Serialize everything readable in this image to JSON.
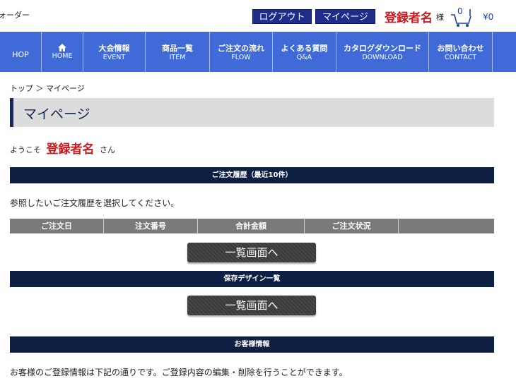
{
  "header": {
    "brand_text": "ォーダー",
    "logout_label": "ログアウト",
    "mypage_label": "マイページ",
    "user_name": "登録者名",
    "honorific": "様",
    "cart_count": "0",
    "cart_price": "¥0"
  },
  "nav": {
    "items": [
      {
        "jp": "HOP",
        "en": ""
      },
      {
        "jp": "",
        "en": "HOME"
      },
      {
        "jp": "大会情報",
        "en": "EVENT"
      },
      {
        "jp": "商品一覧",
        "en": "ITEM"
      },
      {
        "jp": "ご注文の流れ",
        "en": "FLOW"
      },
      {
        "jp": "よくある質問",
        "en": "Q&A"
      },
      {
        "jp": "カタログダウンロード",
        "en": "DOWNLOAD"
      },
      {
        "jp": "お問い合わせ",
        "en": "CONTACT"
      }
    ]
  },
  "breadcrumb": "トップ ＞ マイページ",
  "page_title": "マイページ",
  "welcome": {
    "prefix": "ようこそ",
    "name": "登録者名",
    "suffix": "さん"
  },
  "order_history": {
    "title": "ご注文履歴（最近10件）",
    "instruction": "参照したいご注文履歴を選択してください。",
    "columns": [
      "ご注文日",
      "注文番号",
      "合計金額",
      "ご注文状況",
      ""
    ],
    "list_button": "一覧画面へ"
  },
  "saved_designs": {
    "title": "保存デザイン一覧",
    "list_button": "一覧画面へ"
  },
  "customer_info": {
    "title": "お客様情報",
    "text": "お客様のご登録情報は下記の通りです。ご登録内容の編集・削除を行うことができます。"
  }
}
